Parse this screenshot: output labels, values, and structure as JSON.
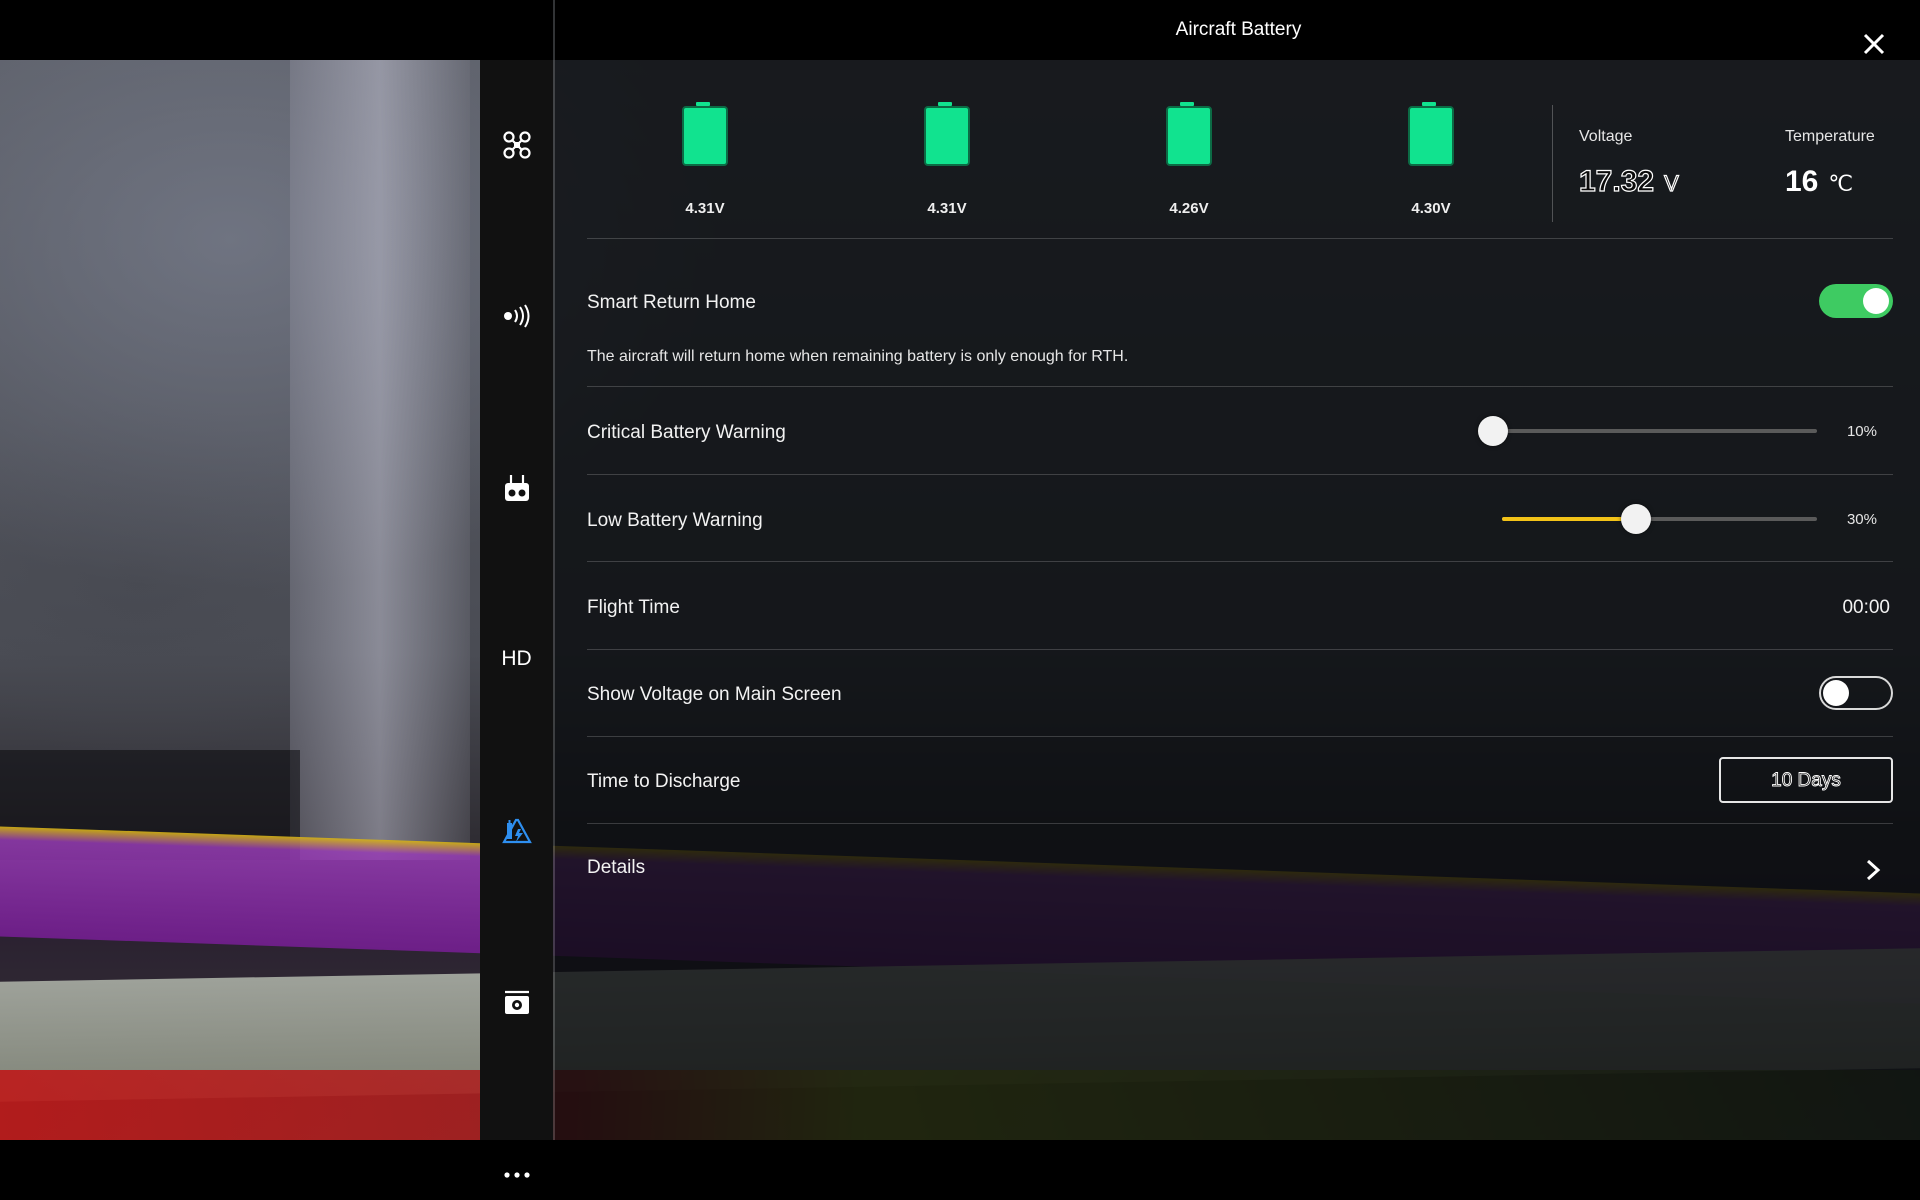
{
  "window": {
    "title": "Aircraft Battery"
  },
  "sidebar": {
    "items": [
      {
        "name": "aircraft-icon"
      },
      {
        "name": "signal-icon"
      },
      {
        "name": "remote-controller-icon"
      },
      {
        "name": "hd-label",
        "label": "HD"
      },
      {
        "name": "battery-icon"
      },
      {
        "name": "camera-icon"
      },
      {
        "name": "more-icon"
      }
    ],
    "active_color": "#2e8ff0"
  },
  "battery": {
    "cells": [
      {
        "voltage": "4.31V"
      },
      {
        "voltage": "4.31V"
      },
      {
        "voltage": "4.26V"
      },
      {
        "voltage": "4.30V"
      }
    ],
    "cell_color": "#11e38f",
    "voltage_label": "Voltage",
    "voltage_value": "17.32",
    "voltage_unit": "V",
    "temperature_label": "Temperature",
    "temperature_value": "16",
    "temperature_unit": "℃"
  },
  "settings": {
    "smart_rth": {
      "label": "Smart Return Home",
      "description": "The aircraft will return home when remaining battery is only enough for RTH.",
      "enabled": true,
      "toggle_color": "#3ecb62"
    },
    "critical_warning": {
      "label": "Critical Battery Warning",
      "value": "10%",
      "level": 0
    },
    "low_warning": {
      "label": "Low Battery Warning",
      "value": "30%",
      "level": 0.42,
      "fill_color": "#f3c318"
    },
    "flight_time": {
      "label": "Flight Time",
      "value": "00:00"
    },
    "show_voltage": {
      "label": "Show Voltage on Main Screen",
      "enabled": false
    },
    "discharge": {
      "label": "Time to Discharge",
      "value": "10 Days"
    },
    "details": {
      "label": "Details"
    }
  }
}
